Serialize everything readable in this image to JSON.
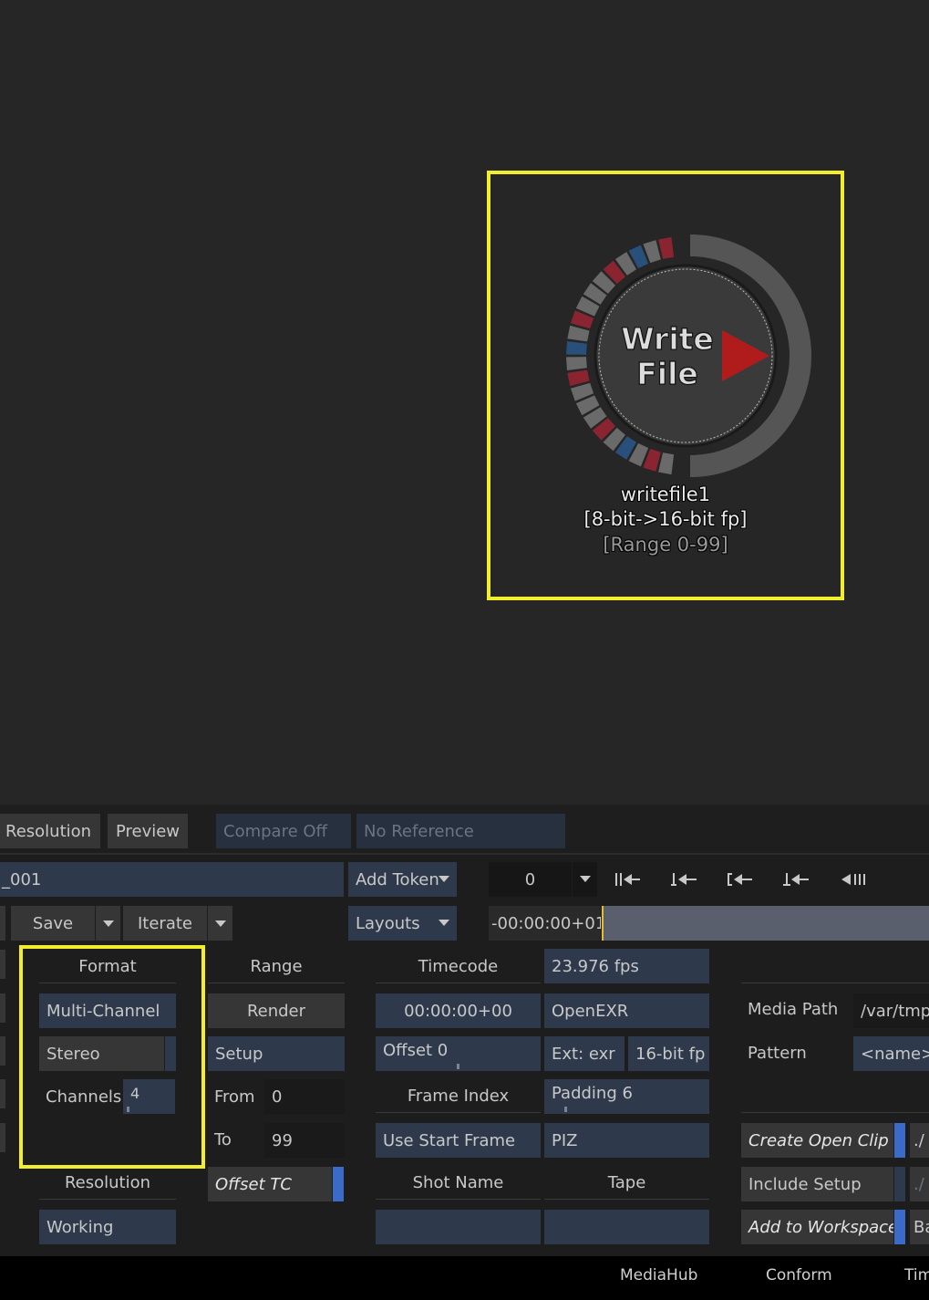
{
  "node": {
    "title_line1": "Write",
    "title_line2": "File",
    "name": "writefile1",
    "bitdepth": "[8-bit->16-bit fp]",
    "range": "[Range  0-99]"
  },
  "topbar": {
    "resolution": "Resolution",
    "preview": "Preview",
    "compare": "Compare Off",
    "reference": "No Reference"
  },
  "row1": {
    "filename": "_001",
    "add_token": "Add Token",
    "frame": "0",
    "transport_icons": [
      "step-back-start-icon",
      "jump-back-icon",
      "mark-in-back-icon",
      "jump-start-icon",
      "play-reverse-icon"
    ]
  },
  "row2": {
    "save": "Save",
    "iterate": "Iterate",
    "layouts": "Layouts",
    "timecode_offset": "-00:00:00+01"
  },
  "format": {
    "header": "Format",
    "multichannel": "Multi-Channel",
    "stereo": "Stereo",
    "channels_label": "Channels",
    "channels_value": "4",
    "resolution_header": "Resolution",
    "resolution_value": "Working"
  },
  "range": {
    "header": "Range",
    "render": "Render",
    "setup": "Setup",
    "from_label": "From",
    "from_value": "0",
    "to_label": "To",
    "to_value": "99",
    "offset_tc": "Offset TC"
  },
  "timecode": {
    "header": "Timecode",
    "value": "00:00:00+00",
    "offset": "Offset 0",
    "frame_index_header": "Frame Index",
    "use_start_frame": "Use Start Frame",
    "shot_name_header": "Shot Name",
    "shot_name_value": ""
  },
  "file": {
    "fps": "23.976 fps",
    "format": "OpenEXR",
    "ext": "Ext: exr",
    "bitdepth": "16-bit fp",
    "padding": "Padding 6",
    "compression": "PIZ",
    "tape_header": "Tape",
    "tape_value": ""
  },
  "media": {
    "path_label": "Media Path",
    "path_value": "/var/tmp/",
    "pattern_label": "Pattern",
    "pattern_value": "<name>",
    "create_open_clip": "Create Open Clip",
    "include_setup": "Include Setup",
    "add_to_workspace": "Add to Workspace",
    "side1": "./",
    "side2": "./",
    "side3": "Ba"
  },
  "bottom_tabs": [
    "MediaHub",
    "Conform",
    "Tim"
  ],
  "colors": {
    "highlight": "#f2ee2e",
    "accent_blue": "#3a6bc8",
    "play_red": "#b01c1c"
  }
}
